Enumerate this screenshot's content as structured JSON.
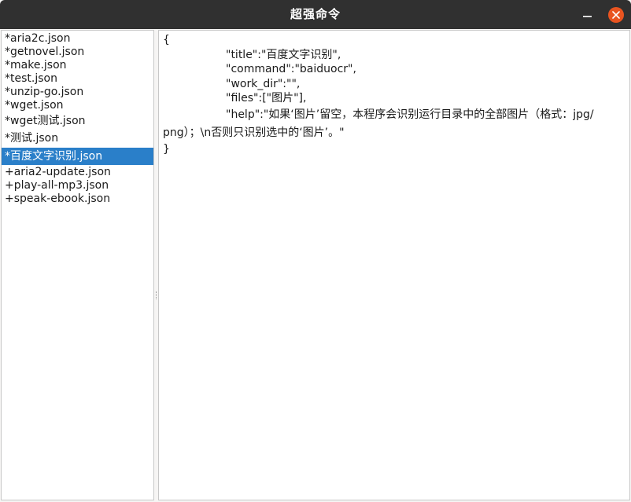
{
  "window": {
    "title": "超强命令"
  },
  "titlebar": {
    "minimize_icon": "minimize-icon",
    "close_icon": "close-icon",
    "close_color": "#e95420"
  },
  "file_list": {
    "items": [
      {
        "label": "*aria2c.json"
      },
      {
        "label": "*getnovel.json"
      },
      {
        "label": "*make.json"
      },
      {
        "label": "*test.json"
      },
      {
        "label": "*unzip-go.json"
      },
      {
        "label": "*wget.json"
      },
      {
        "label": "*wget测试.json"
      },
      {
        "label": "*测试.json"
      },
      {
        "label": "*百度文字识别.json"
      },
      {
        "label": "+aria2-update.json"
      },
      {
        "label": "+play-all-mp3.json"
      },
      {
        "label": "+speak-ebook.json"
      }
    ],
    "selected_index": 8,
    "selected_color": "#2a7fc9"
  },
  "editor": {
    "lines": [
      "{",
      "\"title\":\"百度文字识别\",",
      "\"command\":\"baiduocr\",",
      "\"work_dir\":\"\",",
      "\"files\":[\"图片\"],",
      "\"help\":\"如果‘图片’留空，本程序会识别运行目录中的全部图片（格式：jpg/",
      "png）；\\n否则只识别选中的‘图片’。\"",
      "}"
    ]
  }
}
